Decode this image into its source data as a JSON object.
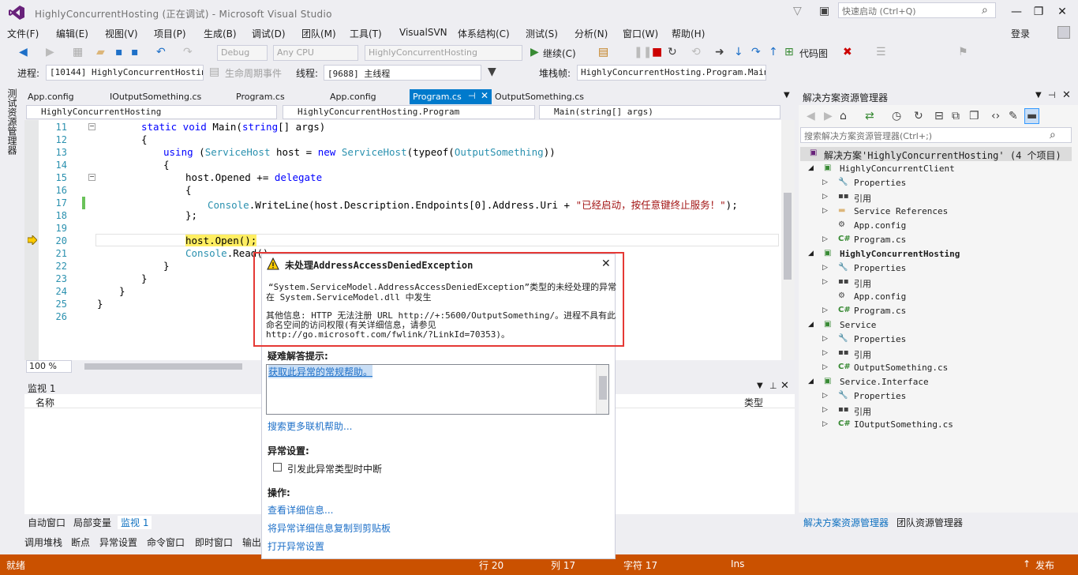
{
  "window": {
    "title": "HighlyConcurrentHosting (正在调试) - Microsoft Visual Studio",
    "quick_launch_placeholder": "快速启动 (Ctrl+Q)",
    "login": "登录"
  },
  "menu": [
    "文件(F)",
    "编辑(E)",
    "视图(V)",
    "项目(P)",
    "生成(B)",
    "调试(D)",
    "团队(M)",
    "工具(T)",
    "VisualSVN",
    "体系结构(C)",
    "测试(S)",
    "分析(N)",
    "窗口(W)",
    "帮助(H)"
  ],
  "toolbar": {
    "config": "Debug",
    "platform": "Any CPU",
    "startup": "HighlyConcurrentHosting",
    "continue_label": "继续(C)",
    "codemap_label": "代码图"
  },
  "debugbar": {
    "process_label": "进程:",
    "process_value": "[10144] HighlyConcurrentHostin",
    "lifecycle_label": "生命周期事件",
    "thread_label": "线程:",
    "thread_value": "[9688] 主线程",
    "stack_label": "堆栈帧:",
    "stack_value": "HighlyConcurrentHosting.Program.Main"
  },
  "left_vtab": "测试资源管理器",
  "doc_tabs": [
    "App.config",
    "IOutputSomething.cs",
    "Program.cs",
    "App.config",
    "Program.cs",
    "OutputSomething.cs"
  ],
  "nav": {
    "project": "HighlyConcurrentHosting",
    "class": "HighlyConcurrentHosting.Program",
    "member": "Main(string[] args)"
  },
  "lines": [
    "11",
    "12",
    "13",
    "14",
    "15",
    "16",
    "17",
    "18",
    "19",
    "20",
    "21",
    "22",
    "23",
    "24",
    "25",
    "26"
  ],
  "code": {
    "l11a": "static void ",
    "l11b": "Main(",
    "l11c": "string",
    "l11d": "[] args)",
    "l12": "{",
    "l13a": "using ",
    "l13b": "(",
    "l13c": "ServiceHost",
    "l13d": " host = ",
    "l13e": "new ",
    "l13f": "ServiceHost",
    "l13g": "(typeof(",
    "l13h": "OutputSomething",
    "l13i": "))",
    "l14": "{",
    "l15a": "host.Opened += ",
    "l15b": "delegate",
    "l16": "{",
    "l17a": "Console",
    "l17b": ".WriteLine(host.Description.Endpoints[0].Address.Uri + ",
    "l17c": "\"已经启动，按任意键终止服务！\"",
    "l17d": ");",
    "l18": "};",
    "l20": "host.Open();",
    "l21a": "Console",
    "l21b": ".Read()",
    "l22": "}",
    "l23": "}",
    "l24": "}",
    "l25": "}"
  },
  "zoom": "100 %",
  "watch": {
    "title": "监视 1",
    "col_name": "名称",
    "col_type": "类型"
  },
  "bottom_tabs1": [
    "自动窗口",
    "局部变量",
    "监视 1"
  ],
  "bottom_tabs2": [
    "调用堆栈",
    "断点",
    "异常设置",
    "命令窗口",
    "即时窗口",
    "输出"
  ],
  "solution_explorer": {
    "title": "解决方案资源管理器",
    "search_placeholder": "搜索解决方案资源管理器(Ctrl+;)",
    "solution": "解决方案'HighlyConcurrentHosting' (4 个项目)",
    "items": [
      {
        "label": "HighlyConcurrentClient",
        "level": 1,
        "icon": "C#"
      },
      {
        "label": "Properties",
        "level": 2,
        "icon": "wrench"
      },
      {
        "label": "引用",
        "level": 2,
        "icon": "ref"
      },
      {
        "label": "Service References",
        "level": 2,
        "icon": "folder"
      },
      {
        "label": "App.config",
        "level": 2,
        "icon": "config"
      },
      {
        "label": "Program.cs",
        "level": 2,
        "icon": "C#"
      },
      {
        "label": "HighlyConcurrentHosting",
        "level": 1,
        "icon": "C#"
      },
      {
        "label": "Properties",
        "level": 2,
        "icon": "wrench"
      },
      {
        "label": "引用",
        "level": 2,
        "icon": "ref"
      },
      {
        "label": "App.config",
        "level": 2,
        "icon": "config"
      },
      {
        "label": "Program.cs",
        "level": 2,
        "icon": "C#"
      },
      {
        "label": "Service",
        "level": 1,
        "icon": "C#"
      },
      {
        "label": "Properties",
        "level": 2,
        "icon": "wrench"
      },
      {
        "label": "引用",
        "level": 2,
        "icon": "ref"
      },
      {
        "label": "OutputSomething.cs",
        "level": 2,
        "icon": "C#"
      },
      {
        "label": "Service.Interface",
        "level": 1,
        "icon": "C#"
      },
      {
        "label": "Properties",
        "level": 2,
        "icon": "wrench"
      },
      {
        "label": "引用",
        "level": 2,
        "icon": "ref"
      },
      {
        "label": "IOutputSomething.cs",
        "level": 2,
        "icon": "C#"
      }
    ],
    "tab_solution": "解决方案资源管理器",
    "tab_team": "团队资源管理器"
  },
  "exception": {
    "title": "未处理AddressAccessDeniedException",
    "msg1": "“System.ServiceModel.AddressAccessDeniedException”类型的未经处理的异常",
    "msg2": "在 System.ServiceModel.dll 中发生",
    "info1": "其他信息: HTTP 无法注册 URL http://+:5600/OutputSomething/。进程不具有此",
    "info2": "命名空间的访问权限(有关详细信息，请参见",
    "info3": "http://go.microsoft.com/fwlink/?LinkId=70353)。",
    "tips_header": "疑难解答提示:",
    "tip_link": "获取此异常的常规帮助。",
    "search_more": "搜索更多联机帮助...",
    "settings_header": "异常设置:",
    "break_checkbox": "引发此异常类型时中断",
    "actions_header": "操作:",
    "view_detail": "查看详细信息...",
    "copy_detail": "将异常详细信息复制到剪贴板",
    "open_settings": "打开异常设置"
  },
  "status": {
    "ready": "就绪",
    "row": "行 20",
    "col": "列 17",
    "char": "字符 17",
    "ins": "Ins",
    "publish": "发布"
  }
}
